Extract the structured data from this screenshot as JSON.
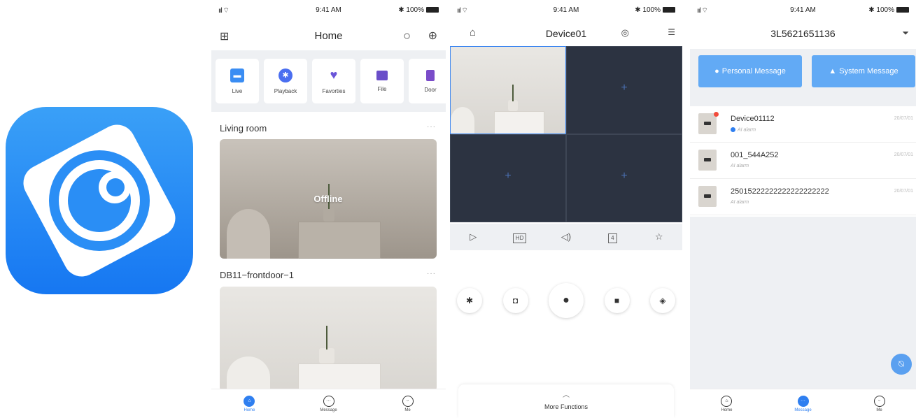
{
  "app_icon": {
    "name": "app-logo"
  },
  "status": {
    "signal": "ııl ⌔",
    "time": "9:41 AM",
    "battery": "✱ 100%"
  },
  "home": {
    "title": "Home",
    "quick": [
      {
        "label": "Live",
        "icon": "camera-icon",
        "color": "#3a8df3"
      },
      {
        "label": "Playback",
        "icon": "playback-icon",
        "color": "#4a6ef0"
      },
      {
        "label": "Favorties",
        "icon": "heart-icon",
        "color": "#6a55d8"
      },
      {
        "label": "File",
        "icon": "folder-icon",
        "color": "#6a4ec9"
      },
      {
        "label": "Door",
        "icon": "door-icon",
        "color": "#7a4cc9"
      }
    ],
    "section1": "Living room",
    "section1_status": "Offline",
    "section2": "DB11−frontdoor−1",
    "more": "···",
    "tabs": [
      {
        "label": "Home",
        "active": true
      },
      {
        "label": "Message",
        "active": false
      },
      {
        "label": "Me",
        "active": false
      }
    ]
  },
  "live": {
    "title": "Device01",
    "controls": [
      "▷",
      "HD",
      "◁)",
      "4",
      "☆"
    ],
    "actions": [
      "playback-action",
      "snapshot",
      "talk",
      "record",
      "ptz"
    ],
    "more_functions": "More Functions",
    "chevron": "︿"
  },
  "message": {
    "title": "3L5621651136",
    "personal": "Personal Message",
    "system": "System Message",
    "rows": [
      {
        "name": "Device01112",
        "sub": "AI alarm",
        "date": "20/07/01",
        "unread": true,
        "badge": true
      },
      {
        "name": "001_544A252",
        "sub": "AI alarm",
        "date": "20/07/01",
        "unread": false,
        "badge": false
      },
      {
        "name": "25015222222222222222222",
        "sub": "AI alarm",
        "date": "20/07/01",
        "unread": false,
        "badge": false
      }
    ],
    "tabs": [
      {
        "label": "Home",
        "active": false
      },
      {
        "label": "Message",
        "active": true
      },
      {
        "label": "Me",
        "active": false
      }
    ]
  }
}
